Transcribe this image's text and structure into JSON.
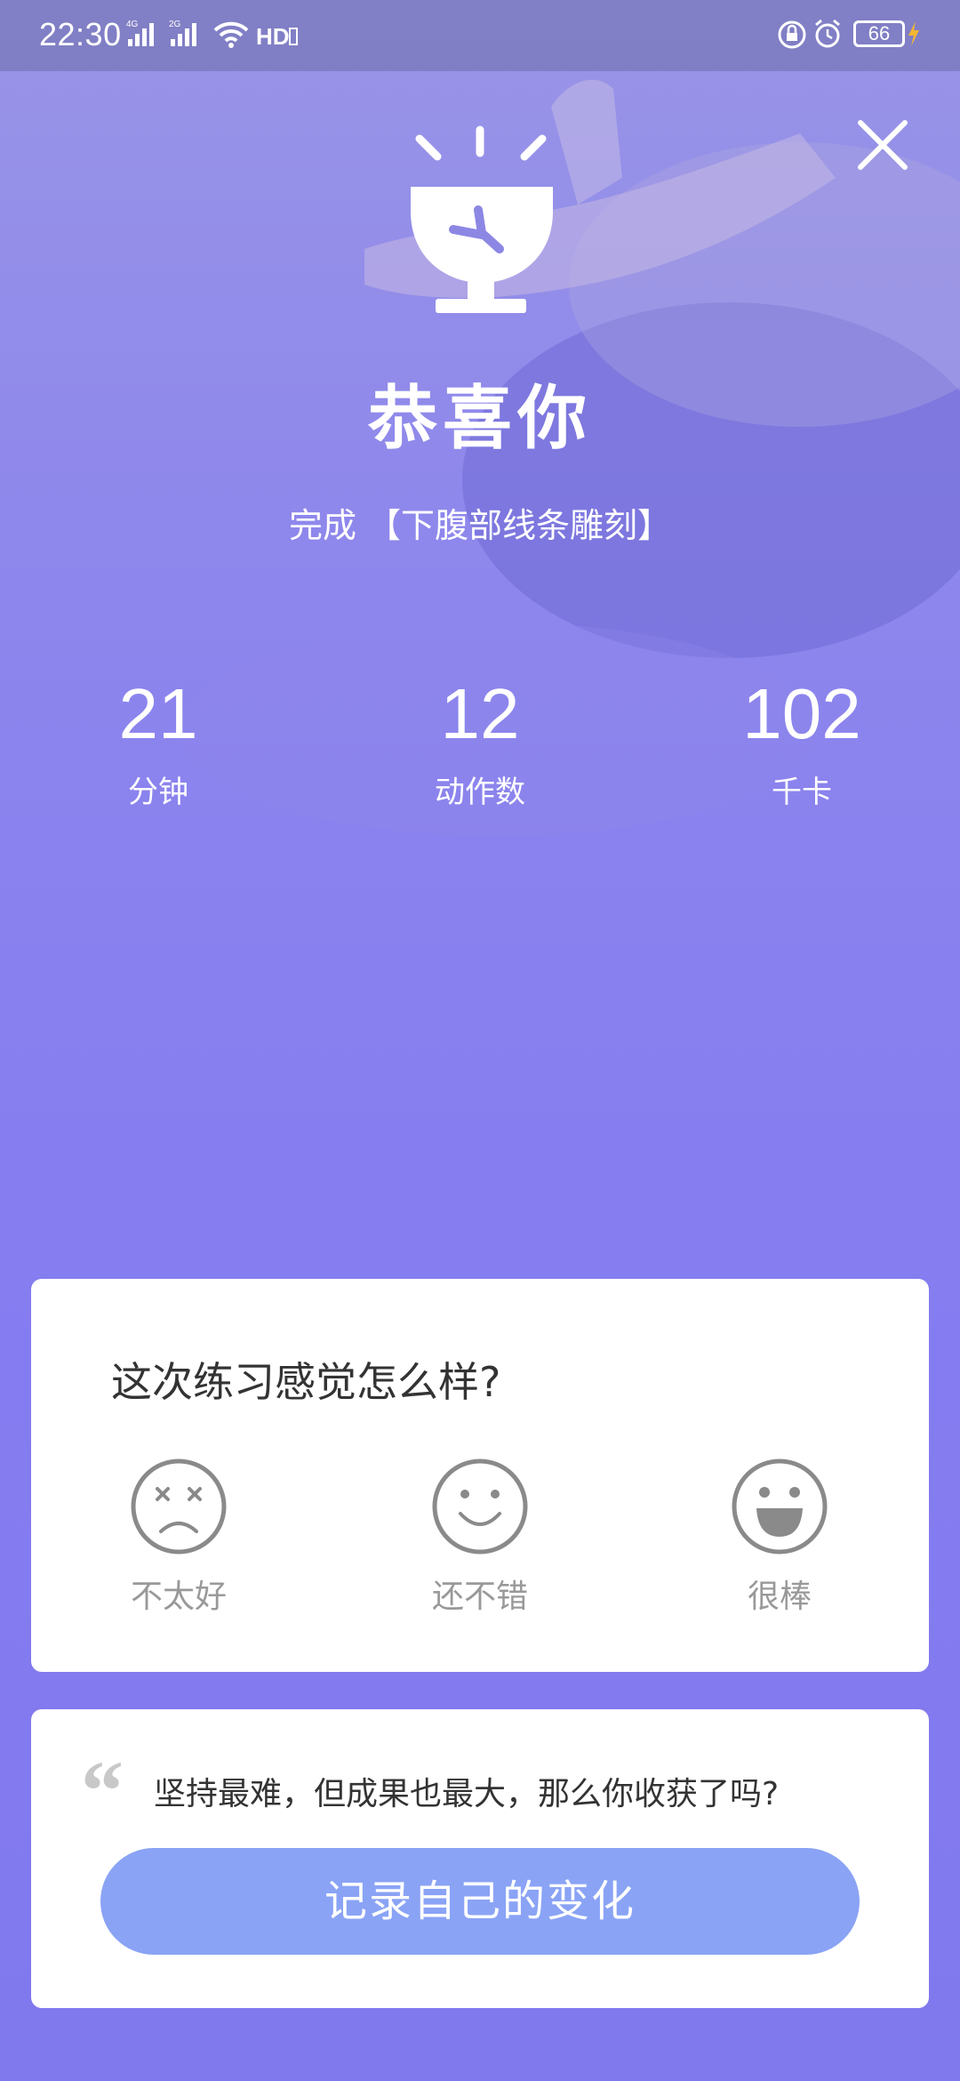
{
  "status_bar": {
    "time": "22:30",
    "battery": "66"
  },
  "header": {
    "title": "恭喜你",
    "subtitle": "完成 【下腹部线条雕刻】"
  },
  "stats": [
    {
      "value": "21",
      "label": "分钟"
    },
    {
      "value": "12",
      "label": "动作数"
    },
    {
      "value": "102",
      "label": "千卡"
    }
  ],
  "feedback": {
    "question": "这次练习感觉怎么样?",
    "options": [
      {
        "label": "不太好",
        "icon": "sad-face-icon"
      },
      {
        "label": "还不错",
        "icon": "smile-face-icon"
      },
      {
        "label": "很棒",
        "icon": "laugh-face-icon"
      }
    ]
  },
  "quote": {
    "mark": "“",
    "text": "坚持最难，但成果也最大，那么你收获了吗?",
    "button_label": "记录自己的变化"
  },
  "colors": {
    "background": "#8a82ee",
    "button": "#8aa3f5",
    "card": "#ffffff",
    "icon_gray": "#8a8a8a"
  }
}
